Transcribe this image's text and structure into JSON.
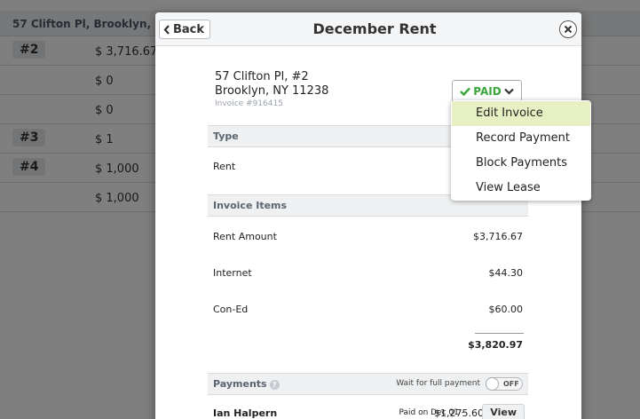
{
  "background": {
    "header_text": "57 Clifton Pl, Brooklyn, NY",
    "rows": [
      {
        "unit": "#2",
        "amount": "$ 3,716.67"
      },
      {
        "unit": "",
        "amount": "$ 0"
      },
      {
        "unit": "",
        "amount": "$ 0"
      },
      {
        "unit": "#3",
        "amount": "$ 1"
      },
      {
        "unit": "#4",
        "amount": "$ 1,000"
      },
      {
        "unit": "",
        "amount": "$ 1,000"
      }
    ]
  },
  "modal": {
    "back_label": "Back",
    "title": "December Rent",
    "address_line1": "57 Clifton Pl, #2",
    "address_line2": "Brooklyn, NY 11238",
    "invoice_number": "Invoice #916415",
    "status_label": "PAID",
    "status_color": "#3aa53a",
    "type_header": "Type",
    "type_value": "Rent",
    "items_header": "Invoice Items",
    "items": [
      {
        "label": "Rent Amount",
        "value": "$3,716.67"
      },
      {
        "label": "Internet",
        "value": "$44.30"
      },
      {
        "label": "Con-Ed",
        "value": "$60.00"
      }
    ],
    "total": "$3,820.97",
    "payments_header": "Payments",
    "wait_label": "Wait for full payment",
    "toggle_label": "OFF",
    "payment": {
      "name": "Ian Halpern",
      "paid_on": "Paid on Dec 01 - ",
      "amount": "$1,275.60",
      "view_label": "View"
    }
  },
  "dropdown": {
    "items": [
      "Edit Invoice",
      "Record Payment",
      "Block Payments",
      "View Lease"
    ],
    "highlight_color": "#e6f0c2"
  }
}
